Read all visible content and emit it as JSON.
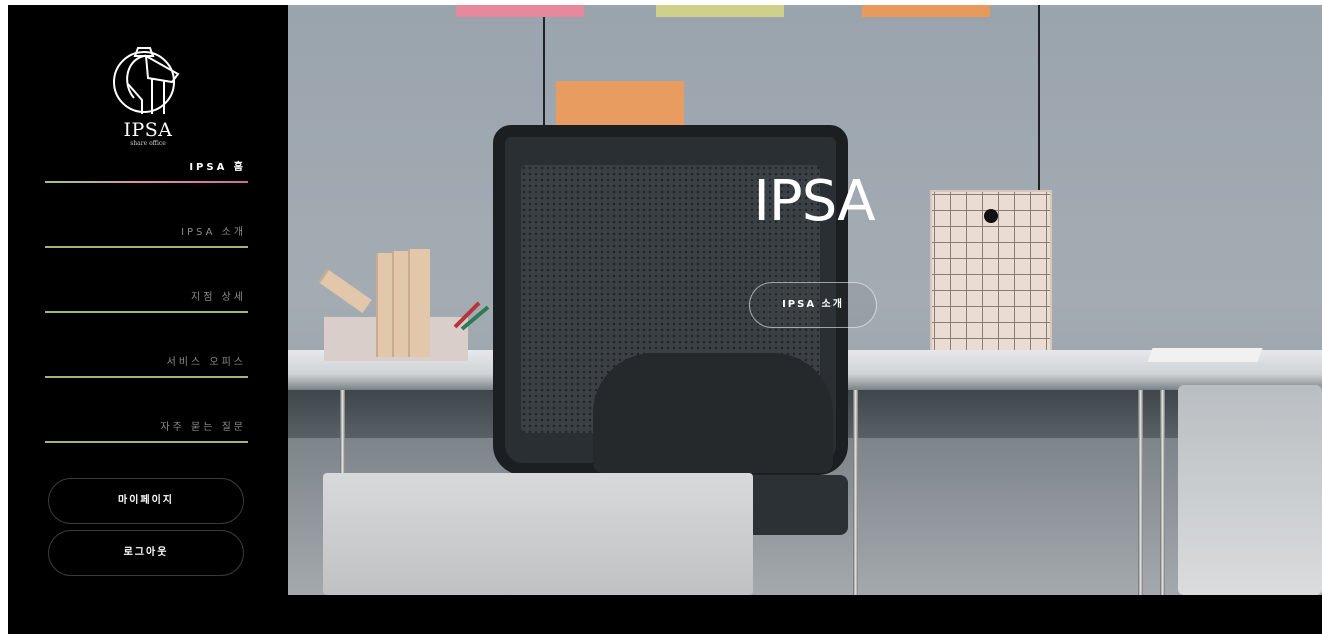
{
  "logo": {
    "name": "IPSA",
    "subtitle": "share office"
  },
  "nav": {
    "items": [
      {
        "label": "IPSA 홈",
        "active": true
      },
      {
        "label": "IPSA 소개",
        "active": false
      },
      {
        "label": "지점 상세",
        "active": false
      },
      {
        "label": "서비스 오피스",
        "active": false
      },
      {
        "label": "자주 묻는 질문",
        "active": false
      }
    ]
  },
  "account": {
    "mypage_label": "마이페이지",
    "logout_label": "로그아웃"
  },
  "hero": {
    "title": "IPSA",
    "button_label": "IPSA 소개"
  },
  "colors": {
    "sidebar_bg": "#000000",
    "nav_active_line": "#e48ca7",
    "nav_line": "#a3b86e",
    "text_primary": "#ffffff",
    "text_muted": "#8d8d8d"
  }
}
